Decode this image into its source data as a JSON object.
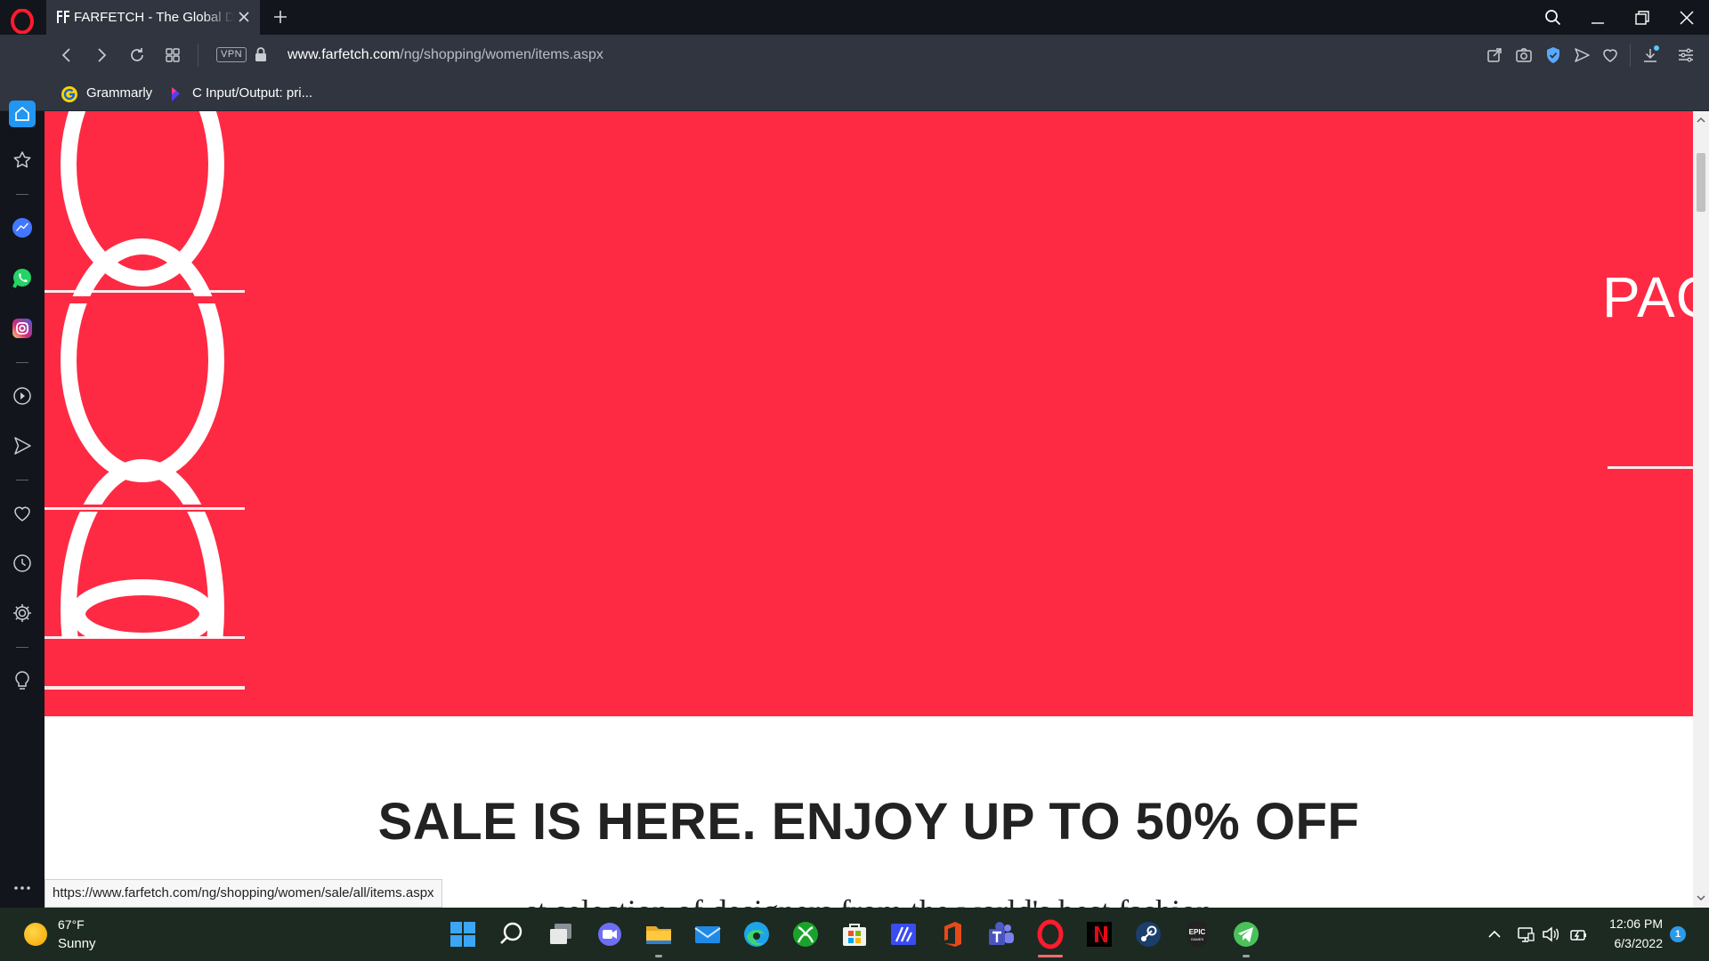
{
  "browser": {
    "tab_title": "FARFETCH - The Global Destination",
    "url_domain": "www.farfetch.com",
    "url_path": "/ng/shopping/women/items.aspx",
    "vpn_label": "VPN"
  },
  "bookmarks": [
    {
      "label": "Grammarly"
    },
    {
      "label": "C Input/Output: pri..."
    }
  ],
  "page": {
    "hero_text": "PAC",
    "headline": "SALE IS HERE. ENJOY UP TO 50% OFF",
    "subtext": "...st selection of designers from the world's best fashion...",
    "hero_color": "#fe2a44"
  },
  "status_url": "https://www.farfetch.com/ng/shopping/women/sale/all/items.aspx",
  "taskbar": {
    "weather_temp": "67°F",
    "weather_condition": "Sunny",
    "time": "12:06 PM",
    "date": "6/3/2022",
    "notification_count": "1"
  }
}
